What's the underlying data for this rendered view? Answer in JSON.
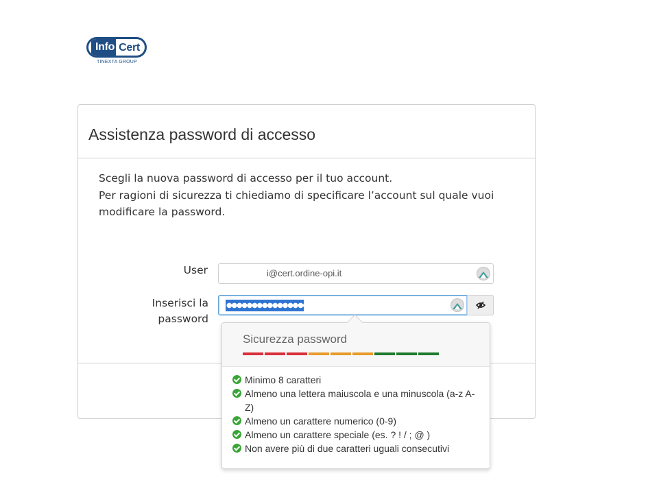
{
  "logo": {
    "brand_left": "Info",
    "brand_right": "Cert",
    "group": "TINEXTA GROUP"
  },
  "card": {
    "title": "Assistenza password di accesso",
    "intro_line1": "Scegli la nuova password di accesso per il tuo account.",
    "intro_line2": "Per ragioni di sicurezza ti chiediamo di specificare l’account sul quale vuoi modificare la password."
  },
  "form": {
    "user_label": "User",
    "user_value": "i@cert.ordine-opi.it",
    "password_label_line1": "Inserisci la",
    "password_label_line2": "password",
    "password_masked": "●●●●●●●●●●●●●●●●"
  },
  "strength": {
    "title": "Sicurezza password",
    "bar_colors": [
      "#d9303b",
      "#d9303b",
      "#d9303b",
      "#e89a2c",
      "#e89a2c",
      "#e89a2c",
      "#1e7a2e",
      "#1e7a2e",
      "#1e7a2e"
    ],
    "requirements": [
      "Minimo 8 caratteri",
      "Almeno una lettera maiuscola e una minuscola (a-z A-Z)",
      "Almeno un carattere numerico (0-9)",
      "Almeno un carattere speciale (es. ? ! / ; @ )",
      "Non avere più di due caratteri uguali consecutivi"
    ]
  },
  "icons": {
    "password_manager": "password-manager-icon",
    "visibility_toggle": "eye-slash-icon",
    "requirement_met": "check-circle-icon"
  }
}
